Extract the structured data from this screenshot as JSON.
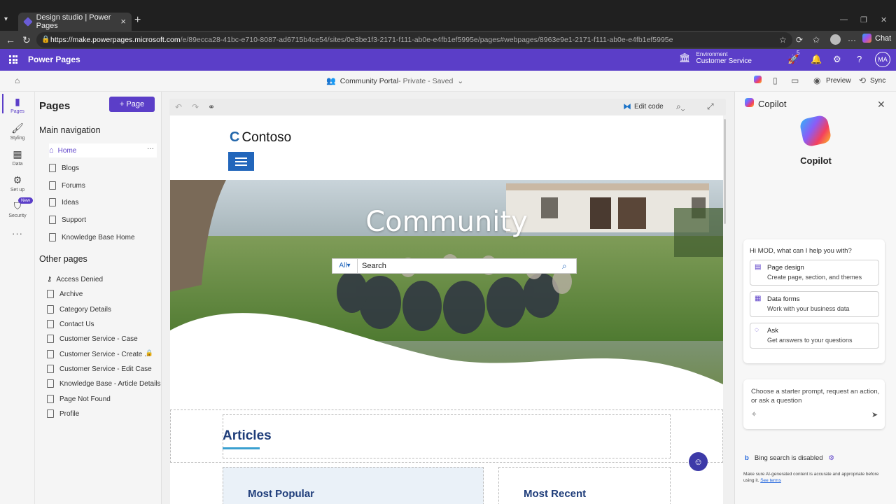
{
  "browser": {
    "tab_title": "Design studio | Power Pages",
    "url_host": "https://make.powerpages.microsoft.com",
    "url_path": "/e/89ecca28-41bc-e710-8087-ad6715b4ce54/sites/0e3be1f3-2171-f111-ab0e-e4fb1ef5995e/pages#webpages/8963e9e1-2171-f111-ab0e-e4fb1ef5995e",
    "chat_label": "Chat"
  },
  "header": {
    "app_name": "Power Pages",
    "env_label": "Environment",
    "env_value": "Customer Service",
    "notif_count": "5",
    "user_initials": "MA"
  },
  "toolbar": {
    "site_name": "Community Portal",
    "site_status": " - Private - Saved",
    "preview_label": "Preview",
    "sync_label": "Sync",
    "edit_code_label": "Edit code"
  },
  "rail": {
    "items": [
      {
        "label": "Pages",
        "icon": "pages-icon"
      },
      {
        "label": "Styling",
        "icon": "styling-icon"
      },
      {
        "label": "Data",
        "icon": "data-icon"
      },
      {
        "label": "Set up",
        "icon": "setup-icon"
      },
      {
        "label": "Security",
        "icon": "security-icon"
      }
    ],
    "new_badge": "New"
  },
  "pages_panel": {
    "title": "Pages",
    "add_label": "+ Page",
    "main_nav_title": "Main navigation",
    "main_nav": [
      "Home",
      "Blogs",
      "Forums",
      "Ideas",
      "Support",
      "Knowledge Base Home"
    ],
    "other_title": "Other pages",
    "other": [
      "Access Denied",
      "Archive",
      "Category Details",
      "Contact Us",
      "Customer Service - Case",
      "Customer Service - Create ...",
      "Customer Service - Edit Case",
      "Knowledge Base - Article Details",
      "Page Not Found",
      "Profile"
    ]
  },
  "site_preview": {
    "brand": "Contoso",
    "hero_title": "Community",
    "search_scope": "All",
    "search_placeholder": "Search",
    "articles_heading": "Articles",
    "card_heading_1": "Most Popular",
    "card_heading_2": "Most Recent"
  },
  "copilot": {
    "title": "Copilot",
    "name": "Copilot",
    "greeting": "Hi MOD, what can I help you with?",
    "suggestions": [
      {
        "title": "Page design",
        "subtitle": "Create page, section, and themes"
      },
      {
        "title": "Data forms",
        "subtitle": "Work with your business data"
      },
      {
        "title": "Ask",
        "subtitle": "Get answers to your questions"
      }
    ],
    "input_placeholder": "Choose a starter prompt, request an action, or ask a question",
    "bing_status": "Bing search is disabled",
    "disclaimer": "Make sure AI-generated content is accurate and appropriate before using it.",
    "terms_link": "See terms"
  },
  "colors": {
    "brand_purple": "#5b3ec8",
    "site_blue": "#2266bb",
    "articles_navy": "#1f3d7a"
  }
}
